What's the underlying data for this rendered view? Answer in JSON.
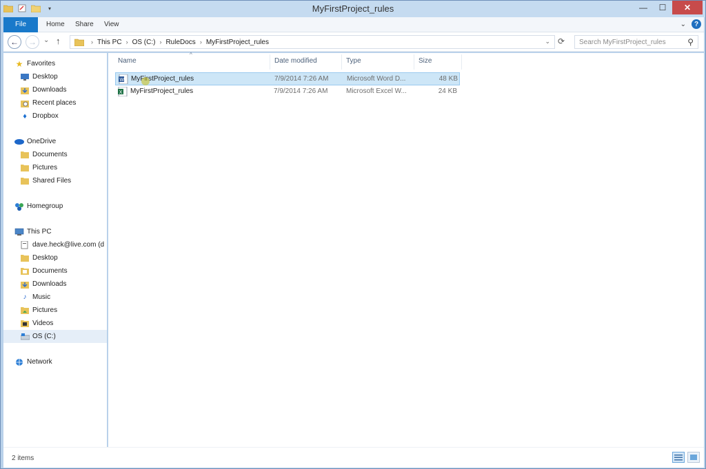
{
  "window": {
    "title": "MyFirstProject_rules",
    "controls": {
      "minimize": "—",
      "maximize": "☐",
      "close": "✕"
    }
  },
  "ribbon": {
    "tabs": [
      "File",
      "Home",
      "Share",
      "View"
    ]
  },
  "navigation": {
    "back": "←",
    "forward": "→",
    "up": "↑",
    "breadcrumb": [
      "This PC",
      "OS (C:)",
      "RuleDocs",
      "MyFirstProject_rules"
    ],
    "search_placeholder": "Search MyFirstProject_rules"
  },
  "nav_pane": {
    "favorites": {
      "label": "Favorites",
      "items": [
        "Desktop",
        "Downloads",
        "Recent places",
        "Dropbox"
      ]
    },
    "onedrive": {
      "label": "OneDrive",
      "items": [
        "Documents",
        "Pictures",
        "Shared Files"
      ]
    },
    "homegroup": {
      "label": "Homegroup"
    },
    "thispc": {
      "label": "This PC",
      "items": [
        "dave.heck@live.com (d",
        "Desktop",
        "Documents",
        "Downloads",
        "Music",
        "Pictures",
        "Videos",
        "OS (C:)"
      ]
    },
    "network": {
      "label": "Network"
    }
  },
  "file_list": {
    "columns": [
      "Name",
      "Date modified",
      "Type",
      "Size"
    ],
    "rows": [
      {
        "name": "MyFirstProject_rules",
        "date": "7/9/2014 7:26 AM",
        "type": "Microsoft Word D...",
        "size": "48 KB",
        "icon": "word-doc-icon"
      },
      {
        "name": "MyFirstProject_rules",
        "date": "7/9/2014 7:26 AM",
        "type": "Microsoft Excel W...",
        "size": "24 KB",
        "icon": "excel-workbook-icon"
      }
    ]
  },
  "status": {
    "item_count": "2 items"
  },
  "colors": {
    "file_tab": "#1979ca",
    "selection": "#cde6f7",
    "close_button": "#c74b4b"
  }
}
